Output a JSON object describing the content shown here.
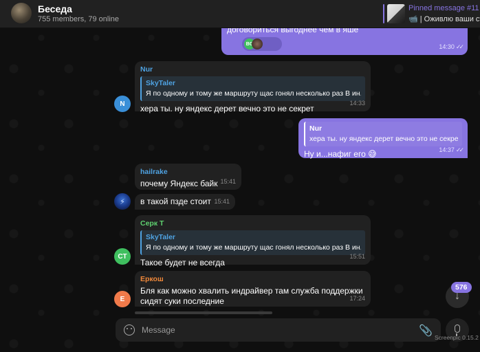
{
  "header": {
    "title": "Беседа",
    "subtitle": "755 members, 79 online",
    "pinned_title": "Pinned message #11",
    "pinned_text": "📹 | Оживлю ваши ст"
  },
  "messages": {
    "m0": {
      "text": "договориться выгоднее чем в яше",
      "time": "14:30",
      "reaction": "BG"
    },
    "m1": {
      "sender": "Nur",
      "reply_name": "SkyTaler",
      "reply_text": "Я по одному и тому же маршруту щас гонял несколько раз В ин...",
      "text": "хера ты. ну яндекс дерет вечно это не секрет",
      "time": "14:33",
      "avatar": "N"
    },
    "m2": {
      "reply_name": "Nur",
      "reply_text": "хера ты. ну яндекс дерет вечно это не секрет",
      "text": "Ну и...нафиг его 😅",
      "time": "14:37"
    },
    "m3": {
      "sender": "hailrake",
      "text": "почему Яндекс байк",
      "time": "15:41"
    },
    "m4": {
      "text": "в такой пзде стоит",
      "time": "15:41"
    },
    "m5": {
      "sender": "Серк Т",
      "reply_name": "SkyTaler",
      "reply_text": "Я по одному и тому же маршруту щас гонял несколько раз В ин...",
      "text": "Такое будет не всегда",
      "time": "15:51",
      "avatar": "CT"
    },
    "m6": {
      "sender": "Еркош",
      "text_line1": "Бля как можно хвалить индрайвер там служба поддержки",
      "text_line2": "сидят суки последние",
      "time": "17:24",
      "avatar": "E"
    }
  },
  "input": {
    "placeholder": "Message"
  },
  "scroll": {
    "unread_count": "576"
  },
  "watermark": "Screenpic 0.15.2",
  "colors": {
    "accent": "#8774e1",
    "background": "#0f0f0f",
    "bubble_in": "#212121"
  }
}
